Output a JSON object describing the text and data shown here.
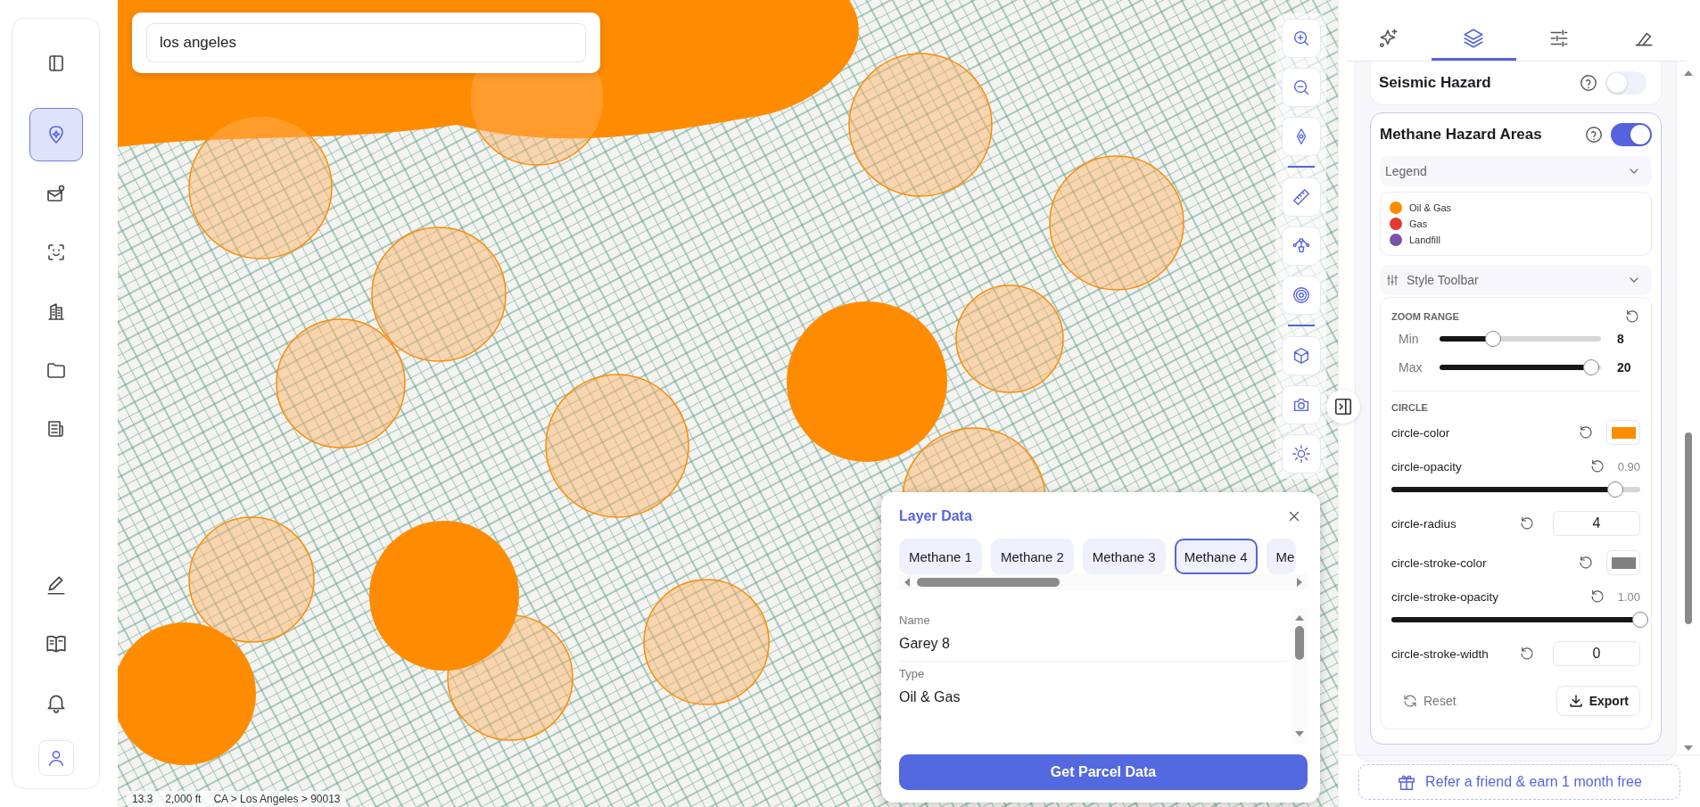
{
  "sidebar": {
    "top_items": [
      {
        "selected": false
      },
      {
        "selected": true
      },
      {
        "selected": false
      },
      {
        "selected": false
      },
      {
        "selected": false
      },
      {
        "selected": false
      },
      {
        "selected": false
      }
    ],
    "bottom_items": [
      {
        "selected": false
      },
      {
        "selected": false
      },
      {
        "selected": false
      }
    ]
  },
  "search": {
    "value": "los angeles"
  },
  "map_status": {
    "zoom": "13.3",
    "scale": "2,000 ft",
    "breadcrumb": "CA > Los Angeles > 90013"
  },
  "layer_popup": {
    "title": "Layer Data",
    "tabs": [
      {
        "label": "Methane 1",
        "selected": false
      },
      {
        "label": "Methane 2",
        "selected": false
      },
      {
        "label": "Methane 3",
        "selected": false
      },
      {
        "label": "Methane 4",
        "selected": true
      },
      {
        "label": "Me",
        "selected": false
      }
    ],
    "fields": [
      {
        "label": "Name",
        "value": "Garey 8"
      },
      {
        "label": "Type",
        "value": "Oil & Gas"
      }
    ],
    "button": "Get Parcel Data"
  },
  "right_panel": {
    "tabs": [
      {
        "selected": false
      },
      {
        "selected": true
      },
      {
        "selected": false
      },
      {
        "selected": false
      }
    ],
    "layers": [
      {
        "title": "Seismic Hazard",
        "on": false
      },
      {
        "title": "Methane Hazard Areas",
        "on": true,
        "legend": {
          "title": "Legend",
          "items": [
            {
              "label": "Oil & Gas",
              "color": "#ff8c00"
            },
            {
              "label": "Gas",
              "color": "#e53935"
            },
            {
              "label": "Landfill",
              "color": "#7b52ab"
            }
          ]
        },
        "style_toolbar": {
          "title": "Style Toolbar",
          "zoom_range": {
            "title": "ZOOM RANGE",
            "rows": [
              {
                "label": "Min",
                "level": 0.33,
                "value": "8"
              },
              {
                "label": "Max",
                "level": 0.94,
                "value": "20"
              }
            ]
          },
          "circle": {
            "title": "CIRCLE",
            "properties": [
              {
                "kind": "color",
                "name": "circle-color",
                "color": "#ff8c00"
              },
              {
                "kind": "slider",
                "name": "circle-opacity",
                "reading": "0.90",
                "level": 0.9
              },
              {
                "kind": "number",
                "name": "circle-radius",
                "value": "4"
              },
              {
                "kind": "color",
                "name": "circle-stroke-color",
                "color": "#808080"
              },
              {
                "kind": "slider",
                "name": "circle-stroke-opacity",
                "reading": "1.00",
                "level": 1
              },
              {
                "kind": "number",
                "name": "circle-stroke-width",
                "value": "0"
              }
            ]
          },
          "reset": "Reset",
          "export": "Export"
        }
      }
    ],
    "referral": "Refer a friend & earn 1 month free"
  }
}
